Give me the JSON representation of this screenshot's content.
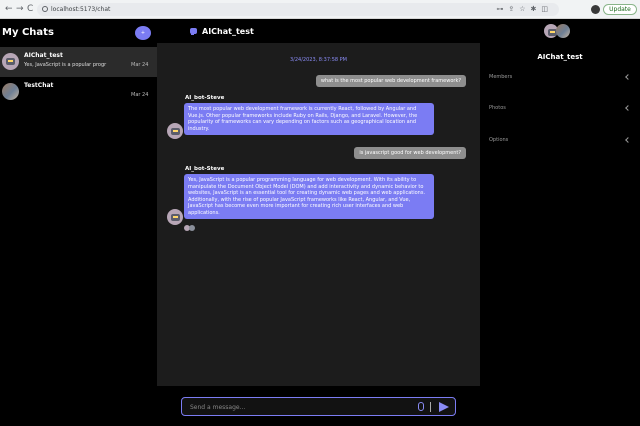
{
  "browser": {
    "url": "localhost:5173/chat",
    "back_icon": "←",
    "forward_icon": "→",
    "reload_icon": "C",
    "update_label": "Update"
  },
  "sidebar": {
    "title": "My Chats",
    "new_chat_icon": "+",
    "chats": [
      {
        "name": "AIChat_test",
        "preview": "Yes, JavaScript is a popular progr",
        "date": "Mar 24",
        "avatar": "robot-avatar"
      },
      {
        "name": "TestChat",
        "preview": "",
        "date": "Mar 24",
        "avatar": "person-avatar"
      }
    ]
  },
  "chat": {
    "title": "AIChat_test",
    "timestamp": "3/24/2023, 8:37:58 PM",
    "messages": [
      {
        "from": "user",
        "text": "what is the most popular web development framework?"
      },
      {
        "from": "bot",
        "sender": "AI_bot-Steve",
        "text": "The most popular web development framework is currently React, followed by Angular and Vue.js. Other popular frameworks include Ruby on Rails, Django, and Laravel. However, the popularity of frameworks can vary depending on factors such as geographical location and industry."
      },
      {
        "from": "user",
        "text": "is javascript good for web development?"
      },
      {
        "from": "bot",
        "sender": "AI_bot-Steve",
        "text": "Yes, JavaScript is a popular programming language for web development. With its ability to manipulate the Document Object Model (DOM) and add interactivity and dynamic behavior to websites, JavaScript is an essential tool for creating dynamic web pages and web applications. Additionally, with the rise of popular JavaScript frameworks like React, Angular, and Vue, JavaScript has become even more important for creating rich user interfaces and web applications."
      }
    ],
    "input_placeholder": "Send a message..."
  },
  "details": {
    "title": "AIChat_test",
    "sections": [
      "Members",
      "Photos",
      "Options"
    ]
  },
  "colors": {
    "accent": "#7b7cf3",
    "user_bubble": "#8e8e8e",
    "chat_bg": "#1c1c1c",
    "active_chat": "#2b2b2b"
  }
}
